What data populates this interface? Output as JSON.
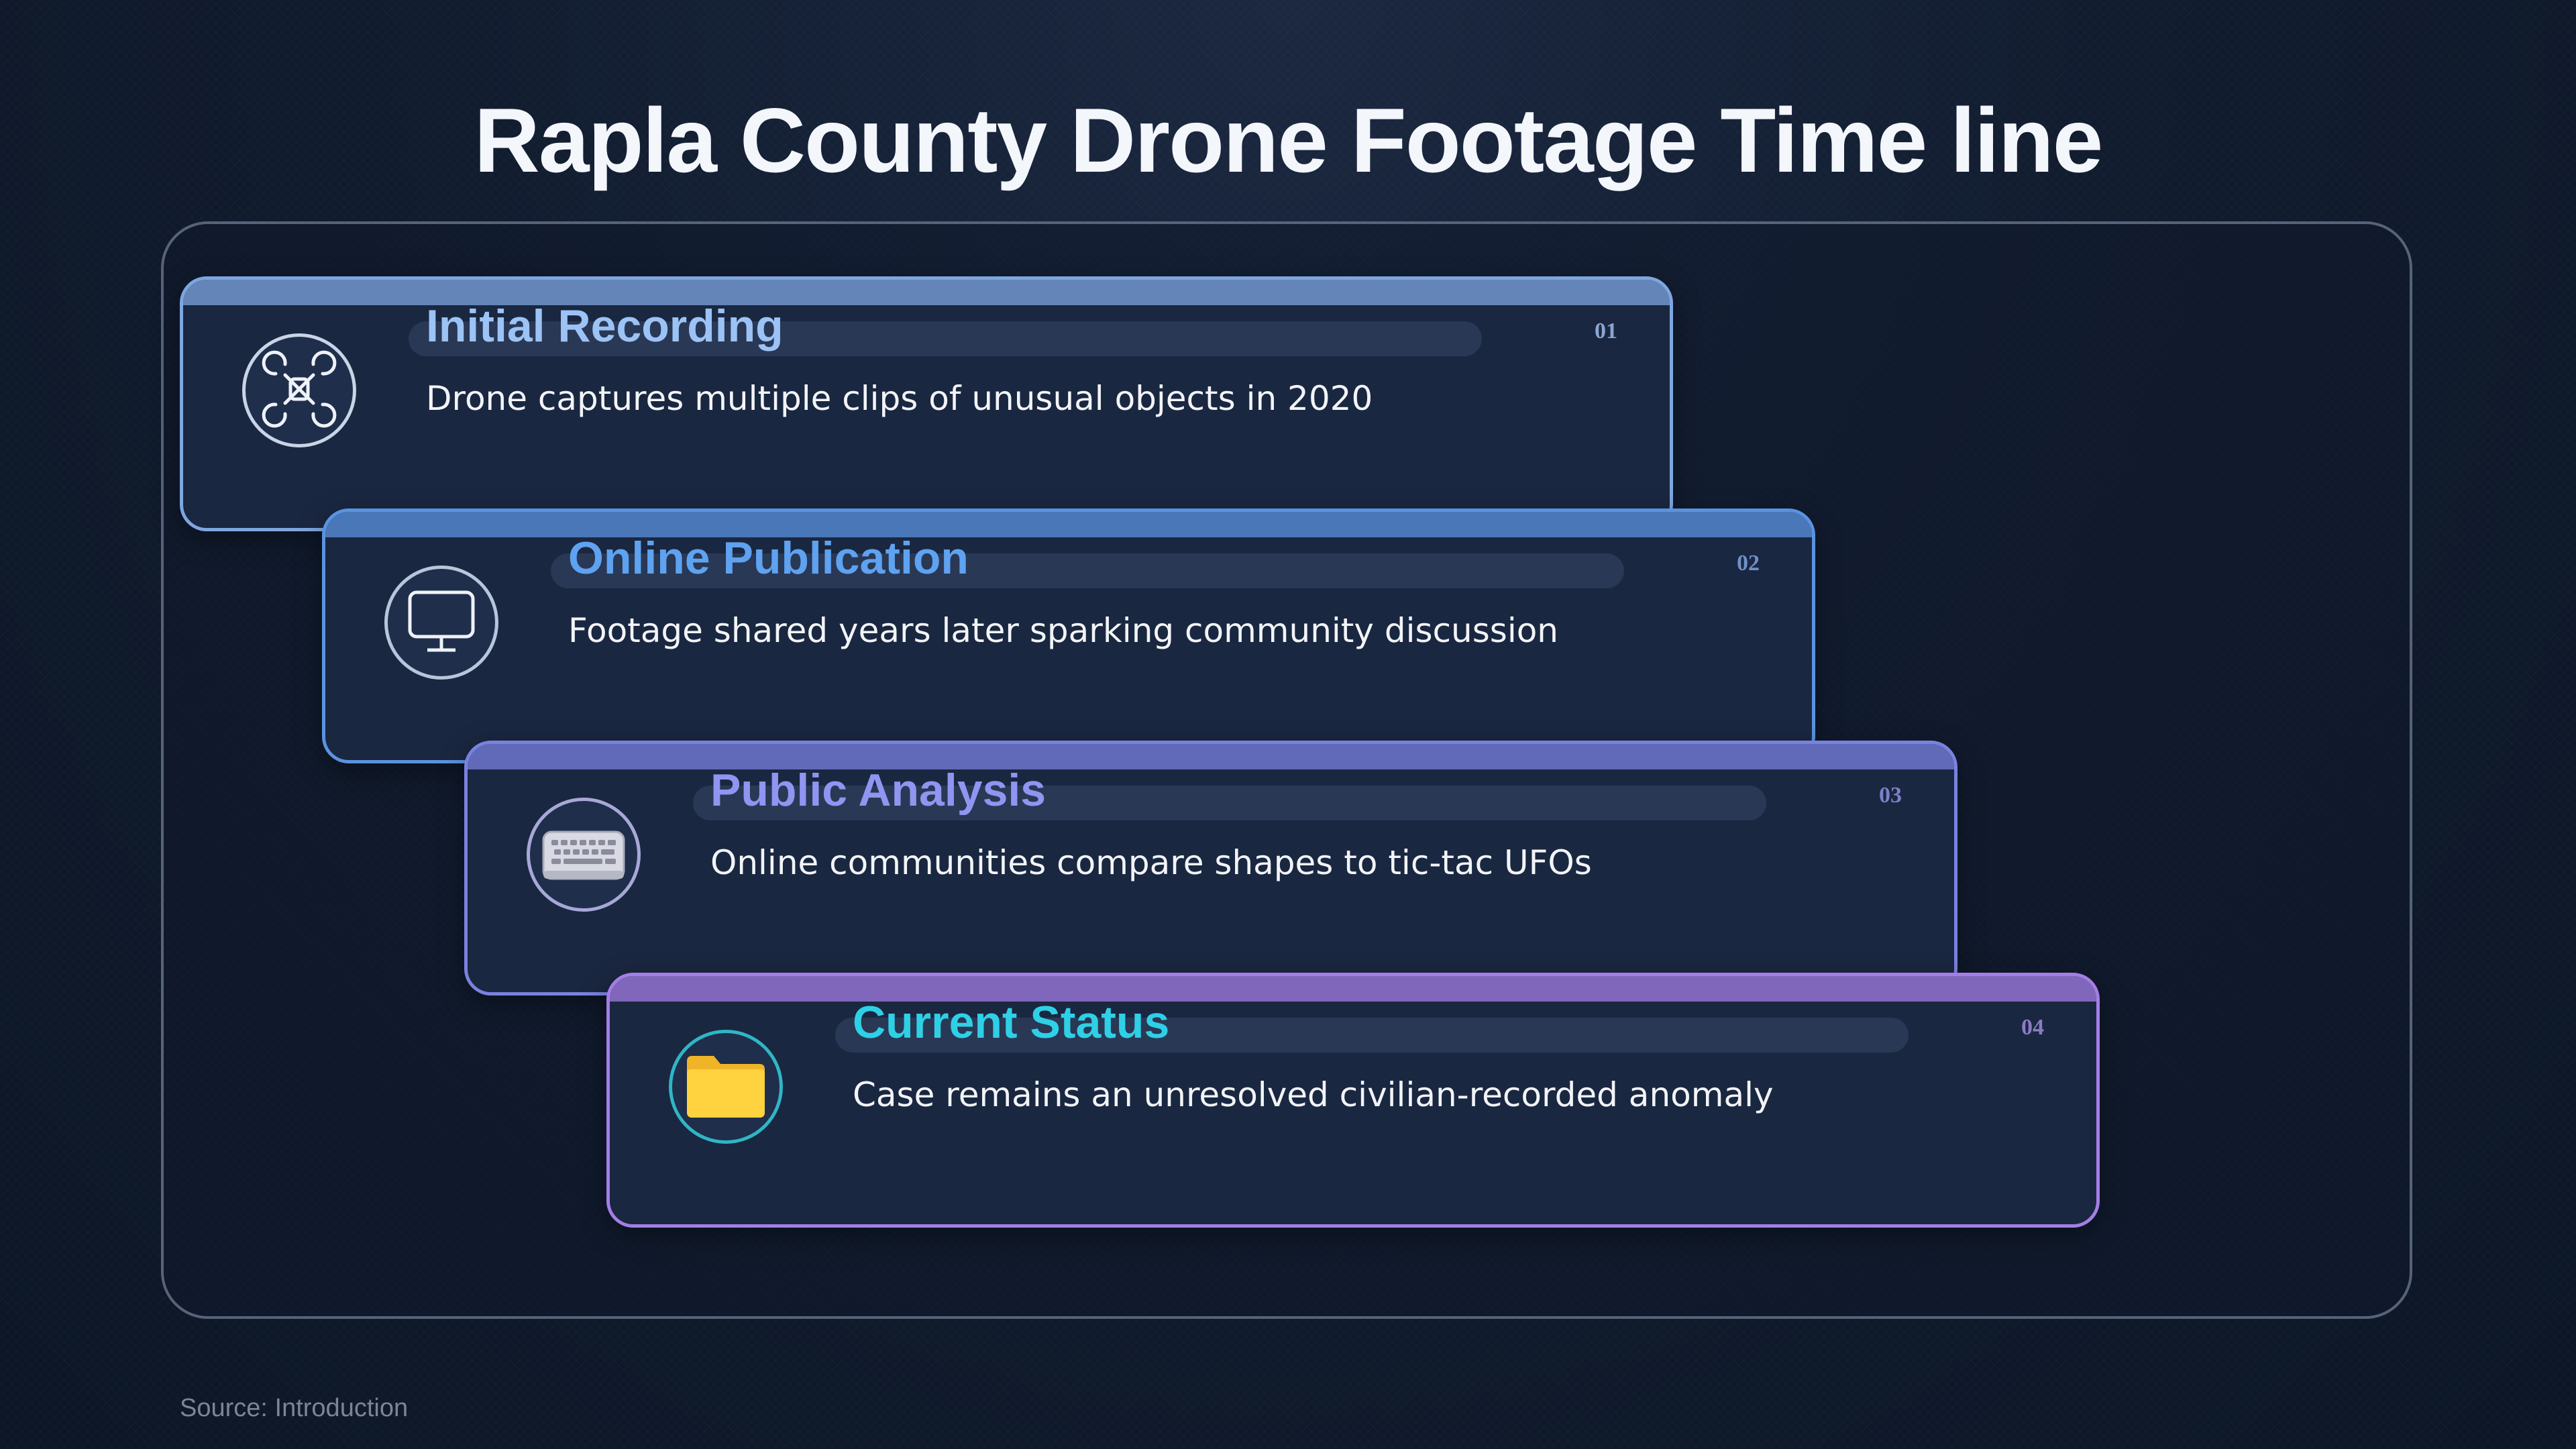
{
  "title": "Rapla County Drone Footage Time line",
  "source": "Source: Introduction",
  "steps": [
    {
      "number": "01",
      "title": "Initial Recording",
      "description": "Drone captures multiple clips of unusual objects in 2020",
      "icon": "drone-icon",
      "accent": "#7ea6e0",
      "title_color": "#9cc3f5"
    },
    {
      "number": "02",
      "title": "Online Publication",
      "description": "Footage shared years later sparking community discussion",
      "icon": "monitor-icon",
      "accent": "#5a93e0",
      "title_color": "#5ea2f0"
    },
    {
      "number": "03",
      "title": "Public Analysis",
      "description": "Online communities compare shapes to tic-tac UFOs",
      "icon": "keyboard-icon",
      "accent": "#7a82e0",
      "title_color": "#8f95f0"
    },
    {
      "number": "04",
      "title": "Current Status",
      "description": "Case remains an unresolved civilian-recorded anomaly",
      "icon": "folder-icon",
      "accent": "#a47ee6",
      "title_color": "#2fd0e6"
    }
  ]
}
